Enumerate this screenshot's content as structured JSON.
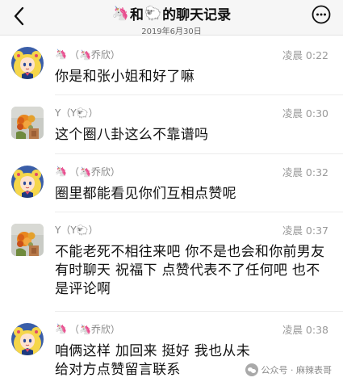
{
  "header": {
    "title_prefix": "🦄",
    "title_and": "和",
    "title_sheep": "🐑",
    "title_suffix": "的聊天记录",
    "subtitle": "2019年6月30日"
  },
  "messages": [
    {
      "sender_icon": "🦄",
      "sender_name": "（🦄乔欣）",
      "time": "凌晨 0:22",
      "text": "你是和张小姐和好了嘛",
      "avatar": "sailor-moon"
    },
    {
      "sender_icon": "",
      "sender_name": "Y（Y🐑）",
      "time": "凌晨 0:30",
      "text": "这个圈八卦这么不靠谱吗",
      "avatar": "flowers"
    },
    {
      "sender_icon": "🦄",
      "sender_name": "（🦄乔欣）",
      "time": "凌晨 0:32",
      "text": "圈里都能看见你们互相点赞呢",
      "avatar": "sailor-moon"
    },
    {
      "sender_icon": "",
      "sender_name": "Y（Y🐑）",
      "time": "凌晨 0:37",
      "text": "不能老死不相往来吧 你不是也会和你前男友有时聊天 祝福下 点赞代表不了任何吧 也不是评论啊",
      "avatar": "flowers"
    },
    {
      "sender_icon": "🦄",
      "sender_name": "（🦄乔欣）",
      "time": "凌晨 0:38",
      "text": "咱俩这样 加回来 挺好 我也从未给对方点赞留言联系",
      "avatar": "sailor-moon"
    }
  ],
  "watermark": {
    "text": "公众号 · 麻辣表哥"
  },
  "colors": {
    "header_bg": "#f6f6f6",
    "time": "#999999",
    "meta": "#888888",
    "text": "#111111"
  }
}
